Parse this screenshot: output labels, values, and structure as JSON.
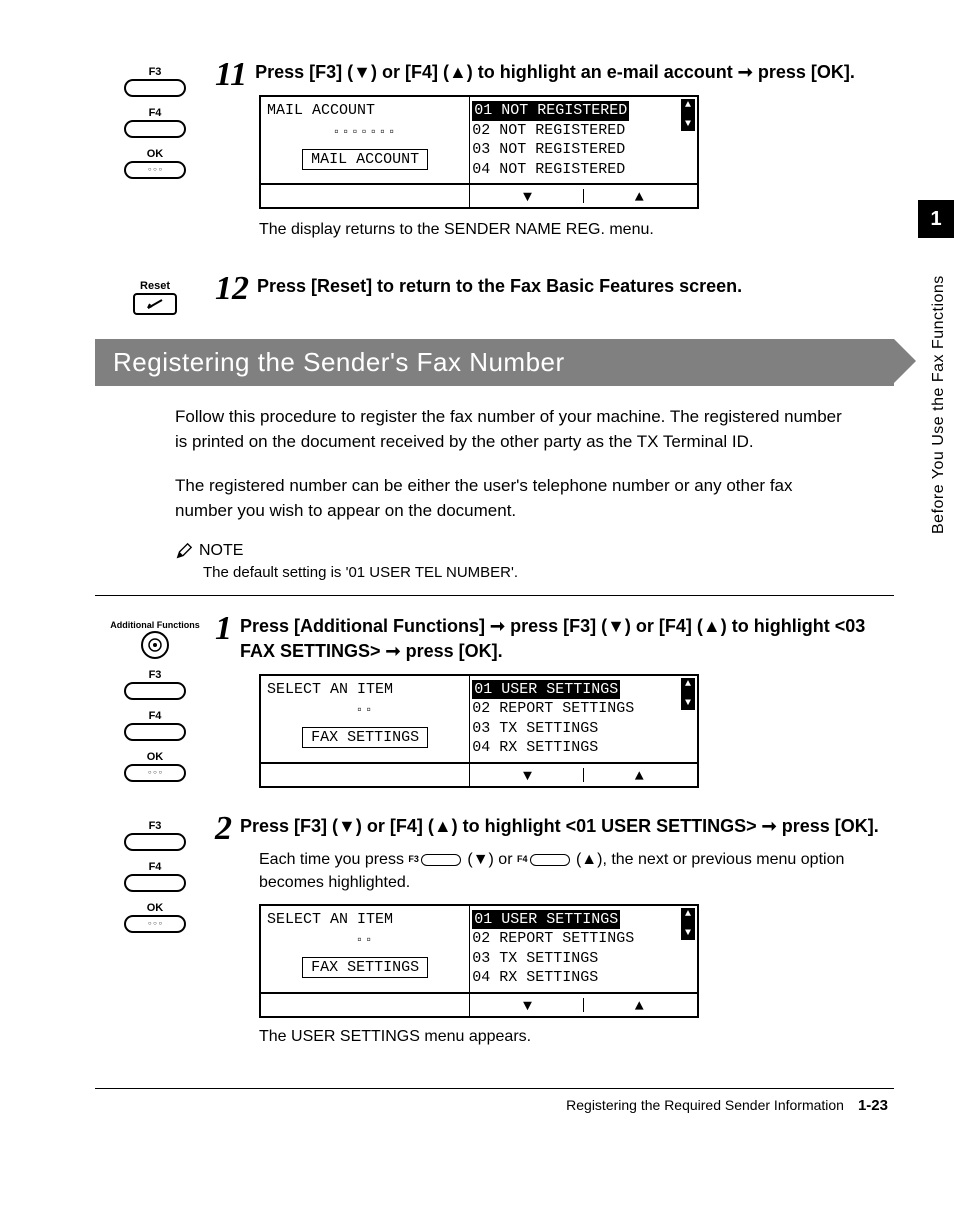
{
  "side": {
    "chapter_num": "1",
    "chapter_title": "Before You Use the Fax Functions"
  },
  "keys": {
    "f3": "F3",
    "f4": "F4",
    "ok": "OK",
    "reset": "Reset",
    "addfn": "Additional Functions"
  },
  "step11": {
    "num": "11",
    "instr_a": "Press [F3] (▼) or [F4] (▲) to highlight an e-mail account ➞ press [OK].",
    "lcd_left_title": "MAIL ACCOUNT",
    "lcd_left_sub": "MAIL ACCOUNT",
    "lcd_rows": [
      "01 NOT REGISTERED",
      "02 NOT REGISTERED",
      "03 NOT REGISTERED",
      "04 NOT REGISTERED"
    ],
    "after": "The display returns to the SENDER NAME REG. menu."
  },
  "step12": {
    "num": "12",
    "instr": "Press [Reset] to return to the Fax Basic Features screen."
  },
  "section": {
    "title": "Registering the Sender's Fax Number"
  },
  "intro1": "Follow this procedure to register the fax number of your machine. The registered number is printed on the document received by the other party as the TX Terminal ID.",
  "intro2": "The registered number can be either the user's telephone number or any other fax number you wish to appear on the document.",
  "note": {
    "label": "NOTE",
    "text": "The default setting is '01 USER TEL NUMBER'."
  },
  "step1": {
    "num": "1",
    "instr": "Press [Additional Functions] ➞ press [F3] (▼) or [F4] (▲) to highlight <03 FAX SETTINGS> ➞ press [OK].",
    "lcd_left_title": "SELECT AN ITEM",
    "lcd_left_sub": "FAX SETTINGS",
    "lcd_rows": [
      "01 USER SETTINGS",
      "02 REPORT SETTINGS",
      "03 TX SETTINGS",
      "04 RX SETTINGS"
    ]
  },
  "step2": {
    "num": "2",
    "instr": "Press [F3] (▼) or [F4] (▲) to highlight <01 USER SETTINGS> ➞ press [OK].",
    "sub_a": "Each time you press ",
    "sub_b": " (▼) or ",
    "sub_c": " (▲), the next or previous menu option becomes highlighted.",
    "lcd_left_title": "SELECT AN ITEM",
    "lcd_left_sub": "FAX SETTINGS",
    "lcd_rows": [
      "01 USER SETTINGS",
      "02 REPORT SETTINGS",
      "03 TX SETTINGS",
      "04 RX SETTINGS"
    ],
    "after": "The USER SETTINGS menu appears."
  },
  "footer": {
    "title": "Registering the Required Sender Information",
    "page": "1-23"
  },
  "glyphs": {
    "down": "▼",
    "up": "▲"
  }
}
